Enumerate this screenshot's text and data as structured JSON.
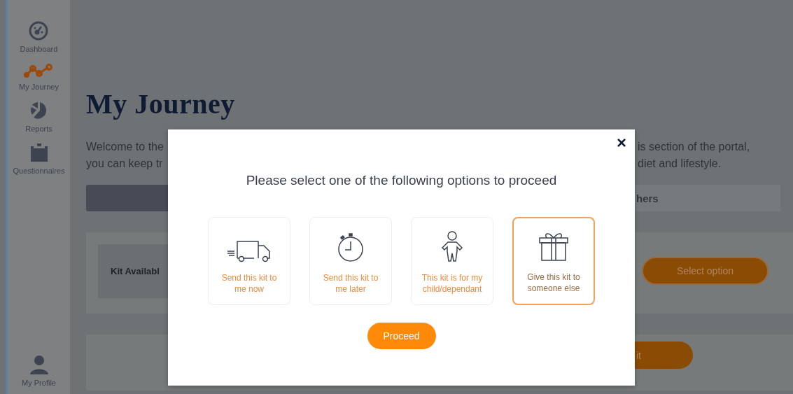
{
  "sidebar": {
    "items": [
      {
        "label": "Dashboard",
        "selected": false
      },
      {
        "label": "My Journey",
        "selected": true
      },
      {
        "label": "Reports",
        "selected": false
      },
      {
        "label": "Questionnaires",
        "selected": false
      }
    ],
    "profile": {
      "label": "My Profile"
    }
  },
  "page": {
    "title": "My Journey",
    "intro_left": [
      "Welcome to the",
      "you can keep tr"
    ],
    "intro_right": [
      "is section of the portal,",
      "diet and lifestyle."
    ],
    "tabs": [
      {
        "selected": true
      },
      {
        "label": "hers",
        "selected": false
      }
    ],
    "kit_card": {
      "label": "Kit Availabl",
      "button": "Select option"
    },
    "second_card": {
      "button": "it"
    }
  },
  "modal": {
    "close": "×",
    "title": "Please select one of the following options to proceed",
    "options": [
      {
        "label": "Send this kit to me now",
        "selected": false
      },
      {
        "label": "Send this kit to me later",
        "selected": false
      },
      {
        "label": "This kit is for my child/dependant",
        "selected": false
      },
      {
        "label": "Give this kit to someone else",
        "selected": true
      }
    ],
    "button": "Proceed"
  }
}
